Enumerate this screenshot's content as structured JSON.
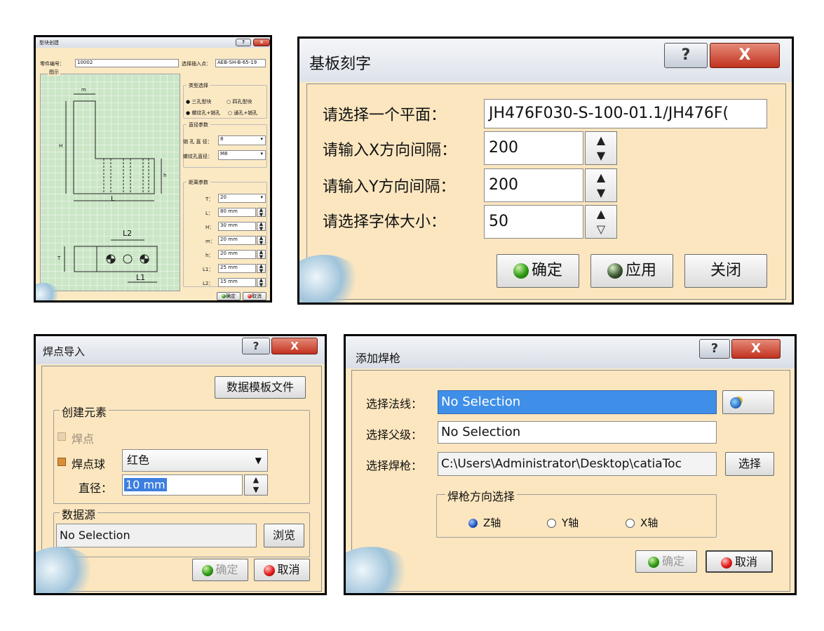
{
  "d1": {
    "title": "型块创建",
    "part_no_label": "零件编号：",
    "part_no_value": "10002",
    "insert_point_label": "选择插入点：",
    "insert_point_value": "AEB-SH-B-65-19",
    "diagram_title": "图示",
    "type_group": "类型选择",
    "type_opt1": "三孔型块",
    "type_opt2": "四孔型块",
    "hole_opt1": "螺纹孔+销孔",
    "hole_opt2": "通孔+销孔",
    "dia_group": "直径参数",
    "pin_dia_label": "销 孔 直 径：",
    "pin_dia_value": "8",
    "thread_dia_label": "螺纹孔直径：",
    "thread_dia_value": "M8",
    "dist_group": "距离参数",
    "params": [
      {
        "label": "T：",
        "value": "20"
      },
      {
        "label": "L：",
        "value": "80 mm"
      },
      {
        "label": "H：",
        "value": "30 mm"
      },
      {
        "label": "m：",
        "value": "20 mm"
      },
      {
        "label": "h：",
        "value": "20 mm"
      },
      {
        "label": "L1：",
        "value": "25 mm"
      },
      {
        "label": "L2：",
        "value": "15 mm"
      }
    ],
    "ok": "确定",
    "cancel": "取消",
    "help": "?",
    "close": "×",
    "dim_labels": {
      "m": "m",
      "H": "H",
      "h": "h",
      "L": "L",
      "L2": "L2",
      "T": "T",
      "L1": "L1"
    }
  },
  "d2": {
    "title": "基板刻字",
    "help": "?",
    "close": "X",
    "plane_label": "请选择一个平面：",
    "plane_value": "JH476F030-S-100-01.1/JH476F(",
    "x_label": "请输入X方向间隔：",
    "x_value": "200",
    "y_label": "请输入Y方向间隔：",
    "y_value": "200",
    "font_label": "请选择字体大小：",
    "font_value": "50",
    "ok": "确定",
    "apply": "应用",
    "close_btn": "关闭"
  },
  "d3": {
    "title": "焊点导入",
    "help": "?",
    "close": "X",
    "template_btn": "数据模板文件",
    "create_group": "创建元素",
    "weld_point": "焊点",
    "weld_ball": "焊点球",
    "color_value": "红色",
    "dia_label": "直径：",
    "dia_value": "10 mm",
    "source_group": "数据源",
    "source_value": "No Selection",
    "browse": "浏览",
    "ok": "确定",
    "cancel": "取消"
  },
  "d4": {
    "title": "添加焊枪",
    "help": "?",
    "close": "X",
    "normal_label": "选择法线：",
    "normal_value": "No Selection",
    "parent_label": "选择父级：",
    "parent_value": "No Selection",
    "gun_label": "选择焊枪：",
    "gun_value": "C:\\Users\\Administrator\\Desktop\\catiaToc",
    "select_btn": "选择",
    "dir_group": "焊枪方向选择",
    "z_axis": "Z轴",
    "y_axis": "Y轴",
    "x_axis": "X轴",
    "ok": "确定",
    "cancel": "取消"
  }
}
